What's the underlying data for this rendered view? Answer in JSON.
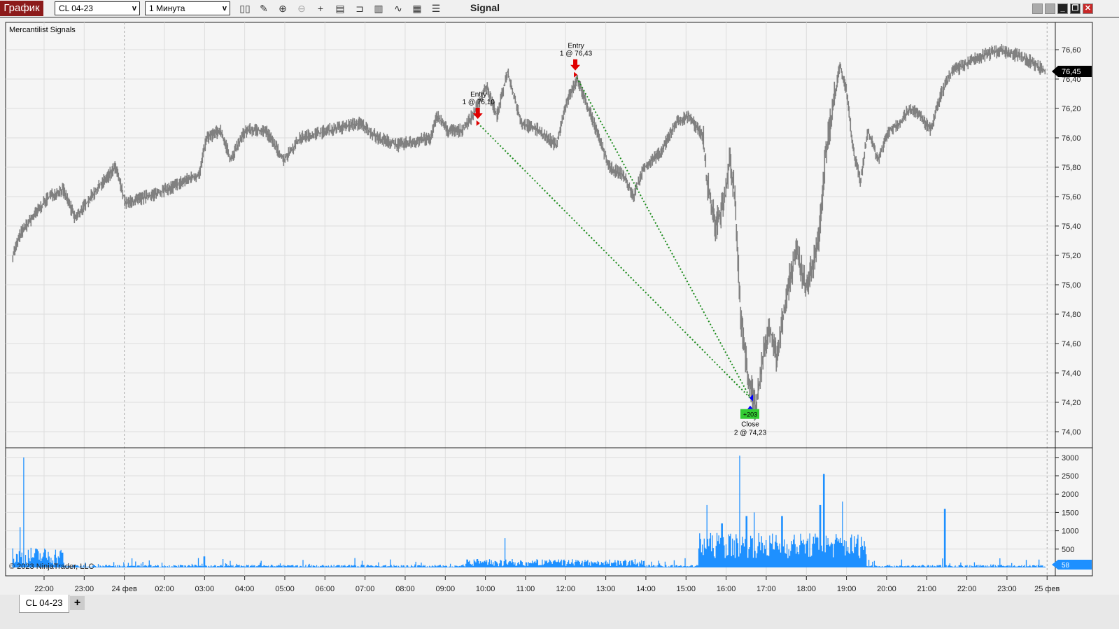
{
  "toolbar": {
    "brand": "График",
    "instrument": "CL 04-23",
    "interval": "1 Минута",
    "title": "Signal",
    "icons": [
      "bar-type-icon",
      "pencil-icon",
      "zoom-in-icon",
      "zoom-out-icon",
      "crosshair-icon",
      "data-box-icon",
      "hotkeys-icon",
      "indicators-icon",
      "strategies-icon",
      "properties-icon",
      "list-icon"
    ]
  },
  "window": {
    "buttons": [
      "restore-gray",
      "restore-gray",
      "minimize",
      "maximize",
      "close"
    ]
  },
  "indicator_label": "Mercantilist Signals",
  "copyright": "© 2023 NinjaTrader, LLC",
  "tabs": {
    "active": "CL 04-23",
    "add": "+"
  },
  "colors": {
    "price": "#808080",
    "volume": "#1e90ff",
    "entry": "#e00000",
    "exit": "#0000ff",
    "trade_line": "#1a8a1a",
    "profit_bg": "#33cc33"
  },
  "chart_data": {
    "type": "line",
    "title": "Signal",
    "x_unit": "session hours from 22:00",
    "x_ticks": [
      {
        "t": 0,
        "label": "22:00"
      },
      {
        "t": 1,
        "label": "23:00"
      },
      {
        "t": 2,
        "label": "24 фев"
      },
      {
        "t": 3,
        "label": "02:00"
      },
      {
        "t": 4,
        "label": "03:00"
      },
      {
        "t": 5,
        "label": "04:00"
      },
      {
        "t": 6,
        "label": "05:00"
      },
      {
        "t": 7,
        "label": "06:00"
      },
      {
        "t": 8,
        "label": "07:00"
      },
      {
        "t": 9,
        "label": "08:00"
      },
      {
        "t": 10,
        "label": "09:00"
      },
      {
        "t": 11,
        "label": "10:00"
      },
      {
        "t": 12,
        "label": "11:00"
      },
      {
        "t": 13,
        "label": "12:00"
      },
      {
        "t": 14,
        "label": "13:00"
      },
      {
        "t": 15,
        "label": "14:00"
      },
      {
        "t": 16,
        "label": "15:00"
      },
      {
        "t": 17,
        "label": "16:00"
      },
      {
        "t": 18,
        "label": "17:00"
      },
      {
        "t": 19,
        "label": "18:00"
      },
      {
        "t": 20,
        "label": "19:00"
      },
      {
        "t": 21,
        "label": "20:00"
      },
      {
        "t": 22,
        "label": "21:00"
      },
      {
        "t": 23,
        "label": "22:00"
      },
      {
        "t": 24,
        "label": "23:00"
      },
      {
        "t": 25,
        "label": "25 фев"
      }
    ],
    "price_ylim": [
      74.0,
      76.6
    ],
    "price_ticks": [
      "76,60",
      "76,40",
      "76,20",
      "76,00",
      "75,80",
      "75,60",
      "75,40",
      "75,20",
      "75,00",
      "74,80",
      "74,60",
      "74,40",
      "74,20",
      "74,00"
    ],
    "last_price": "76,45",
    "price": [
      [
        -0.78,
        75.2
      ],
      [
        -0.58,
        75.35
      ],
      [
        -0.31,
        75.45
      ],
      [
        0.12,
        75.6
      ],
      [
        0.47,
        75.65
      ],
      [
        0.78,
        75.45
      ],
      [
        1.17,
        75.6
      ],
      [
        1.78,
        75.8
      ],
      [
        2.04,
        75.55
      ],
      [
        2.56,
        75.6
      ],
      [
        3.09,
        75.65
      ],
      [
        3.44,
        75.7
      ],
      [
        3.87,
        75.75
      ],
      [
        4.05,
        76.0
      ],
      [
        4.4,
        76.05
      ],
      [
        4.66,
        75.85
      ],
      [
        5.01,
        76.05
      ],
      [
        5.53,
        76.05
      ],
      [
        5.97,
        75.85
      ],
      [
        6.4,
        76.0
      ],
      [
        7.1,
        76.05
      ],
      [
        7.88,
        76.1
      ],
      [
        8.32,
        76.0
      ],
      [
        8.84,
        75.95
      ],
      [
        9.63,
        76.0
      ],
      [
        9.8,
        76.15
      ],
      [
        10.06,
        76.05
      ],
      [
        10.41,
        76.05
      ],
      [
        10.68,
        76.15
      ],
      [
        11.02,
        76.35
      ],
      [
        11.29,
        76.15
      ],
      [
        11.55,
        76.45
      ],
      [
        11.9,
        76.1
      ],
      [
        12.33,
        76.05
      ],
      [
        12.77,
        75.95
      ],
      [
        13.03,
        76.25
      ],
      [
        13.29,
        76.4
      ],
      [
        13.64,
        76.15
      ],
      [
        14.08,
        75.8
      ],
      [
        14.43,
        75.75
      ],
      [
        14.69,
        75.6
      ],
      [
        14.95,
        75.8
      ],
      [
        15.38,
        75.9
      ],
      [
        15.73,
        76.1
      ],
      [
        16.08,
        76.15
      ],
      [
        16.43,
        76.0
      ],
      [
        16.52,
        75.7
      ],
      [
        16.73,
        75.4
      ],
      [
        16.95,
        75.55
      ],
      [
        17.09,
        75.85
      ],
      [
        17.22,
        75.6
      ],
      [
        17.36,
        74.8
      ],
      [
        17.53,
        74.4
      ],
      [
        17.74,
        74.15
      ],
      [
        17.91,
        74.5
      ],
      [
        18.09,
        74.7
      ],
      [
        18.26,
        74.5
      ],
      [
        18.52,
        74.95
      ],
      [
        18.75,
        75.25
      ],
      [
        18.96,
        75.0
      ],
      [
        19.13,
        75.1
      ],
      [
        19.31,
        75.3
      ],
      [
        19.48,
        75.9
      ],
      [
        19.66,
        76.2
      ],
      [
        19.83,
        76.5
      ],
      [
        20.01,
        76.3
      ],
      [
        20.18,
        75.9
      ],
      [
        20.35,
        75.7
      ],
      [
        20.53,
        76.05
      ],
      [
        20.79,
        75.85
      ],
      [
        21.05,
        76.05
      ],
      [
        21.32,
        76.1
      ],
      [
        21.58,
        76.2
      ],
      [
        21.84,
        76.15
      ],
      [
        22.1,
        76.05
      ],
      [
        22.36,
        76.3
      ],
      [
        22.62,
        76.45
      ],
      [
        22.97,
        76.5
      ],
      [
        23.32,
        76.55
      ],
      [
        23.85,
        76.6
      ],
      [
        24.37,
        76.55
      ],
      [
        24.72,
        76.5
      ],
      [
        24.96,
        76.45
      ]
    ],
    "volume_ylim": [
      0,
      3000
    ],
    "volume_ticks": [
      "3000",
      "2500",
      "2000",
      "1500",
      "1000",
      "500"
    ],
    "last_volume": "58",
    "volume_peaks": [
      [
        -0.51,
        3000
      ],
      [
        -0.6,
        1100
      ],
      [
        4.0,
        300
      ],
      [
        11.49,
        800
      ],
      [
        16.52,
        1700
      ],
      [
        16.9,
        1200
      ],
      [
        17.34,
        3050
      ],
      [
        17.5,
        1400
      ],
      [
        17.7,
        1500
      ],
      [
        18.4,
        1400
      ],
      [
        19.43,
        2550
      ],
      [
        19.35,
        1700
      ],
      [
        19.9,
        1800
      ],
      [
        22.45,
        1600
      ]
    ],
    "trades": [
      {
        "type": "Entry",
        "t": 10.81,
        "price": 76.1,
        "label": "Entry",
        "detail": "1 @ 76,10"
      },
      {
        "type": "Entry",
        "t": 13.24,
        "price": 76.43,
        "label": "Entry",
        "detail": "1 @ 76,43"
      },
      {
        "type": "Close",
        "t": 17.6,
        "price": 74.23,
        "label": "Close",
        "detail": "2 @ 74,23",
        "profit": "+203"
      }
    ]
  }
}
